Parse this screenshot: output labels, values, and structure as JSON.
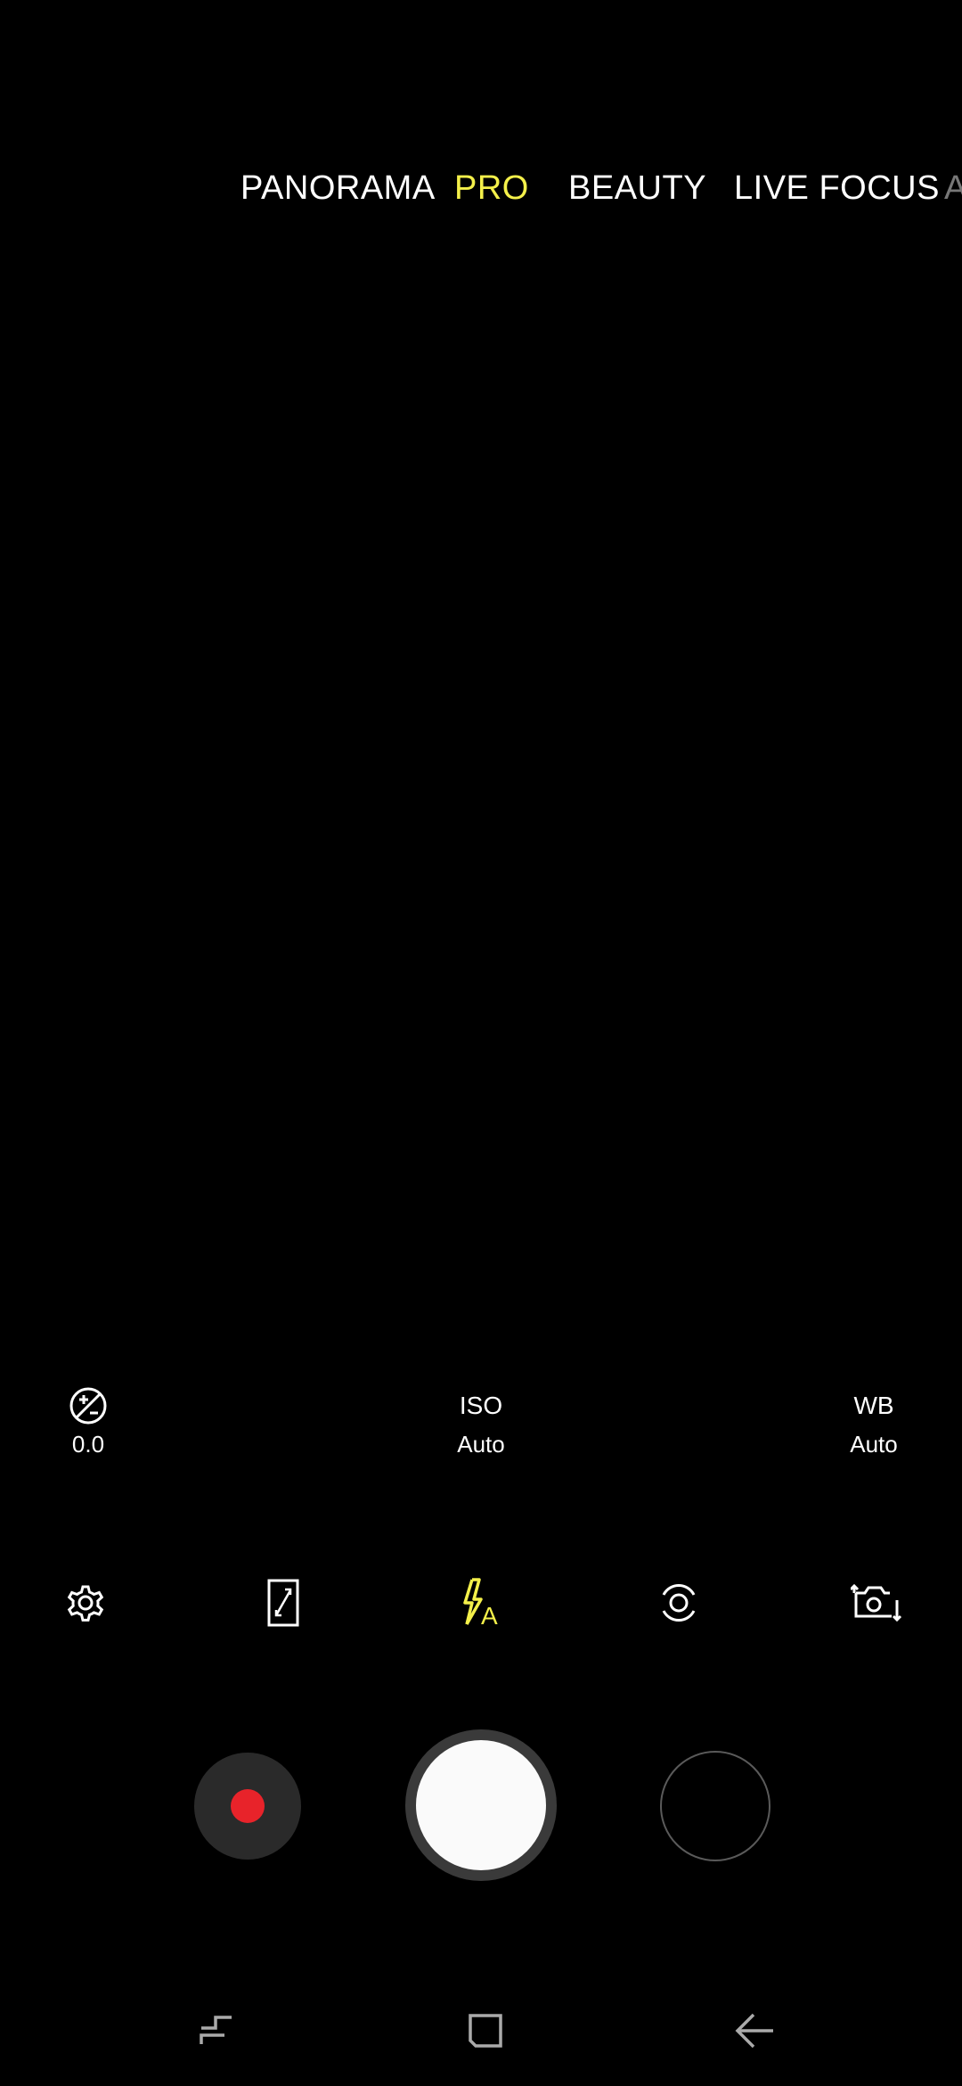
{
  "modes": {
    "panorama": "PANORAMA",
    "pro": "PRO",
    "beauty": "BEAUTY",
    "live_focus": "LIVE FOCUS",
    "next_partial": "A"
  },
  "active_mode": "PRO",
  "pro_controls": {
    "exposure": {
      "icon": "exposure-icon",
      "value": "0.0"
    },
    "iso": {
      "label": "ISO",
      "value": "Auto"
    },
    "wb": {
      "label": "WB",
      "value": "Auto"
    }
  },
  "quick_settings": {
    "settings_icon": "gear-icon",
    "aspect_icon": "aspect-ratio-icon",
    "flash_icon": "flash-auto-icon",
    "effects_icon": "camera-effects-icon",
    "switch_icon": "switch-camera-icon"
  },
  "colors": {
    "accent": "#f4f04a",
    "record": "#e8232a",
    "background": "#000000"
  },
  "navbar": {
    "recents_icon": "recents-icon",
    "home_icon": "home-icon",
    "back_icon": "back-icon"
  }
}
